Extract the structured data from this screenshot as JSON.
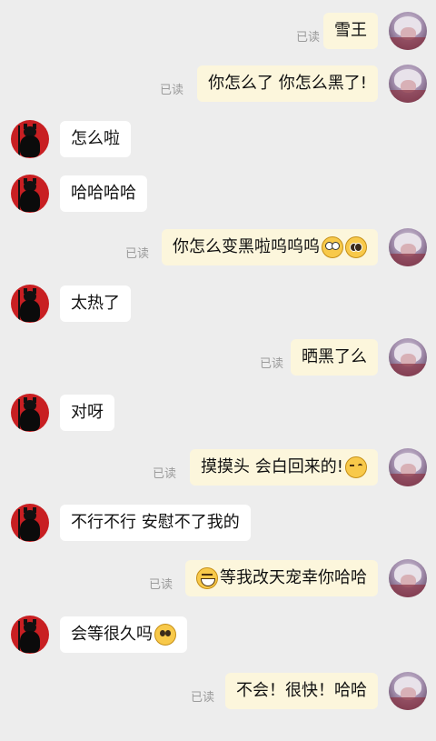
{
  "read_label": "已读",
  "messages": [
    {
      "side": "self",
      "text": "雪王",
      "read": true
    },
    {
      "side": "self",
      "text": "你怎么了 你怎么黑了!",
      "read": true
    },
    {
      "side": "other",
      "text": "怎么啦"
    },
    {
      "side": "other",
      "text": "哈哈哈哈"
    },
    {
      "side": "self",
      "text": "你怎么变黑啦呜呜呜",
      "read": true,
      "emoji_after": [
        "shocked-emoji",
        "pleading-emoji"
      ]
    },
    {
      "side": "other",
      "text": "太热了"
    },
    {
      "side": "self",
      "text": "晒黑了么",
      "read": true
    },
    {
      "side": "other",
      "text": "对呀"
    },
    {
      "side": "self",
      "text": "摸摸头 会白回来的!",
      "read": true,
      "emoji_after": [
        "wink-emoji"
      ]
    },
    {
      "side": "other",
      "text": "不行不行 安慰不了我的"
    },
    {
      "side": "self",
      "text": "等我改天宠幸你哈哈",
      "read": true,
      "emoji_before": [
        "grin-emoji"
      ]
    },
    {
      "side": "other",
      "text": "会等很久吗",
      "emoji_after": [
        "pleading-emoji"
      ]
    },
    {
      "side": "self",
      "text": "不会！很快！哈哈",
      "read": true
    }
  ]
}
